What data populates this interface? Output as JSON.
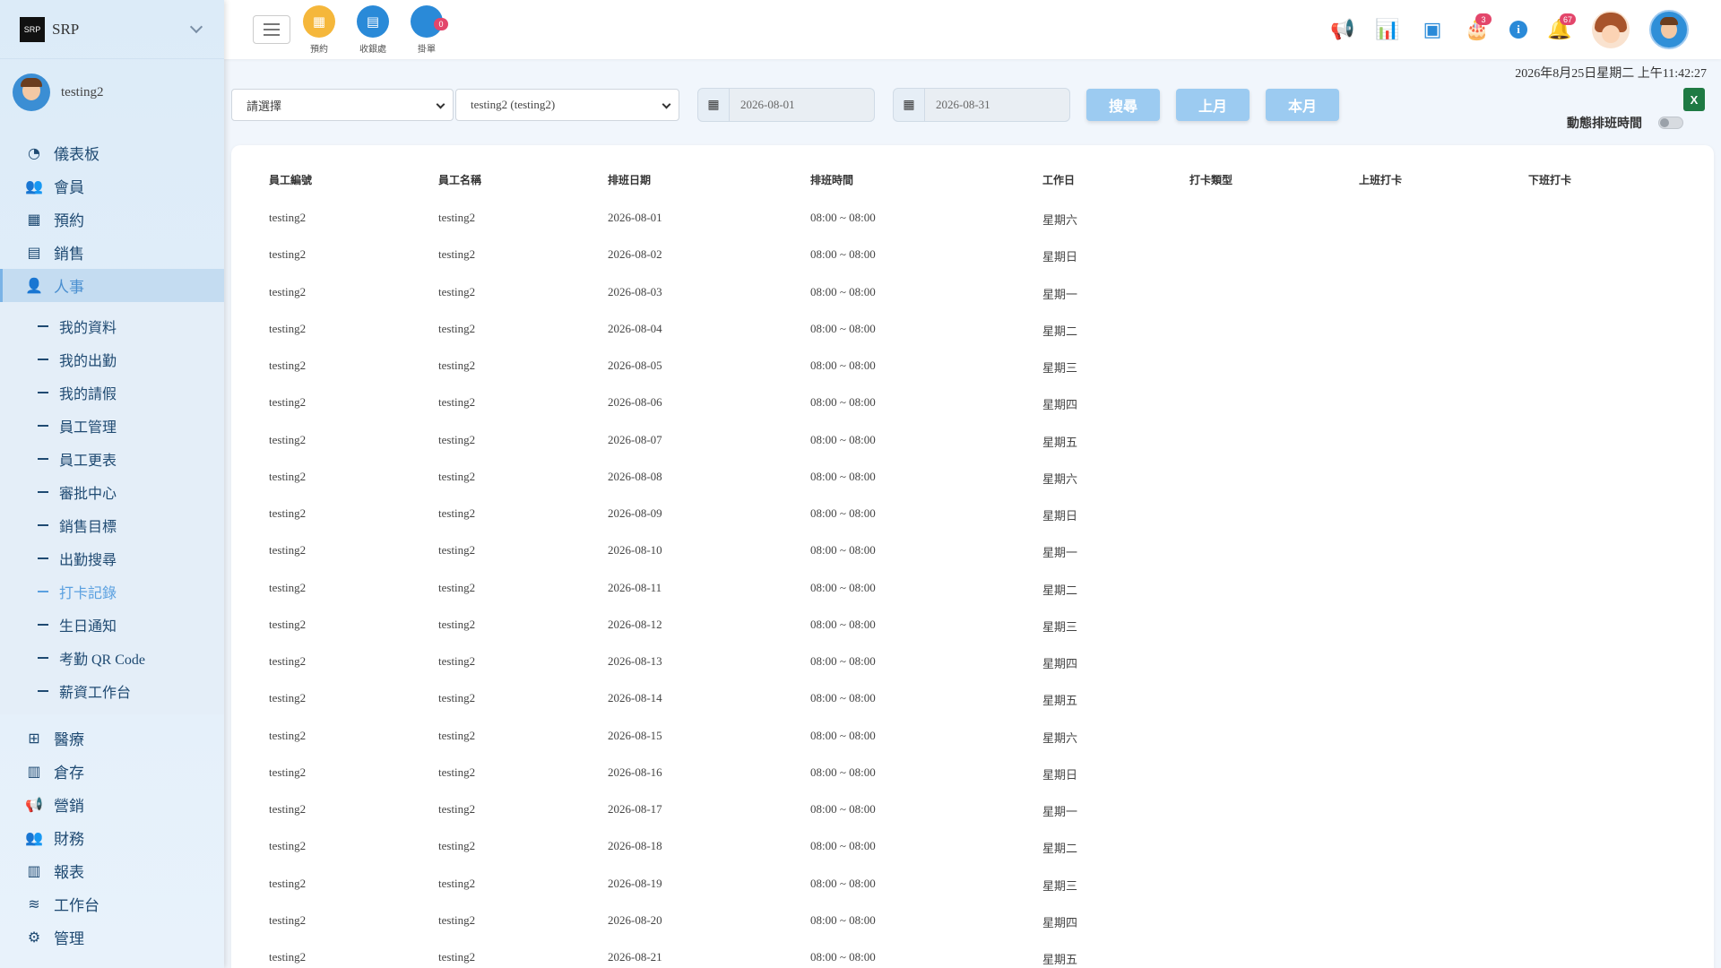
{
  "sidebar": {
    "brand": "SRP",
    "logo_text": "SRP",
    "username": "testing2",
    "menu_top": [
      {
        "label": "儀表板",
        "icon": "pie-chart-icon",
        "glyph": "◔"
      },
      {
        "label": "會員",
        "icon": "users-icon",
        "glyph": "👥"
      },
      {
        "label": "預約",
        "icon": "calendar-icon",
        "glyph": "▦"
      },
      {
        "label": "銷售",
        "icon": "id-card-icon",
        "glyph": "▤"
      },
      {
        "label": "人事",
        "icon": "user-icon",
        "glyph": "👤"
      }
    ],
    "submenu": [
      "我的資料",
      "我的出勤",
      "我的請假",
      "員工管理",
      "員工更表",
      "審批中心",
      "銷售目標",
      "出勤搜尋",
      "打卡記錄",
      "生日通知",
      "考勤 QR Code",
      "薪資工作台"
    ],
    "menu_bottom": [
      {
        "label": "醫療",
        "icon": "medical-icon",
        "glyph": "⊞"
      },
      {
        "label": "倉存",
        "icon": "warehouse-icon",
        "glyph": "▥"
      },
      {
        "label": "營銷",
        "icon": "megaphone-icon",
        "glyph": "📢"
      },
      {
        "label": "財務",
        "icon": "users-icon",
        "glyph": "👥"
      },
      {
        "label": "報表",
        "icon": "bar-chart-icon",
        "glyph": "▥"
      },
      {
        "label": "工作台",
        "icon": "layers-icon",
        "glyph": "≋"
      },
      {
        "label": "管理",
        "icon": "gear-icon",
        "glyph": "⚙"
      }
    ]
  },
  "topbar": {
    "quick": [
      {
        "label": "預約",
        "icon": "calendar-icon",
        "glyph": "▦",
        "color": "#f5b73b",
        "badge": ""
      },
      {
        "label": "收銀處",
        "icon": "cashier-icon",
        "glyph": "▤",
        "color": "#2a8ad8",
        "badge": ""
      },
      {
        "label": "掛單",
        "icon": "pending-icon",
        "glyph": "",
        "color": "#2a8ad8",
        "badge": "0"
      }
    ],
    "right": {
      "megaphone_glyph": "📢",
      "chart_glyph": "📊",
      "qr_glyph": "▣",
      "cake_glyph": "🎂",
      "cake_badge": "3",
      "info_glyph": "i",
      "bell_glyph": "🔔",
      "bell_badge": "67"
    }
  },
  "datetime": "2026年8月25日星期二 上午11:42:27",
  "filters": {
    "select1": "請選擇",
    "select2": "testing2 (testing2)",
    "date_from": "2026-08-01",
    "date_to": "2026-08-31",
    "calendar_glyph": "▦",
    "search_label": "搜尋",
    "prev_month_label": "上月",
    "this_month_label": "本月",
    "excel_glyph": "X",
    "toggle_label": "動態排班時間"
  },
  "table": {
    "headers": [
      "員工編號",
      "員工名稱",
      "排班日期",
      "排班時間",
      "工作日",
      "打卡類型",
      "上班打卡",
      "下班打卡"
    ],
    "rows": [
      [
        "testing2",
        "testing2",
        "2026-08-01",
        "08:00 ~ 08:00",
        "星期六"
      ],
      [
        "testing2",
        "testing2",
        "2026-08-02",
        "08:00 ~ 08:00",
        "星期日"
      ],
      [
        "testing2",
        "testing2",
        "2026-08-03",
        "08:00 ~ 08:00",
        "星期一"
      ],
      [
        "testing2",
        "testing2",
        "2026-08-04",
        "08:00 ~ 08:00",
        "星期二"
      ],
      [
        "testing2",
        "testing2",
        "2026-08-05",
        "08:00 ~ 08:00",
        "星期三"
      ],
      [
        "testing2",
        "testing2",
        "2026-08-06",
        "08:00 ~ 08:00",
        "星期四"
      ],
      [
        "testing2",
        "testing2",
        "2026-08-07",
        "08:00 ~ 08:00",
        "星期五"
      ],
      [
        "testing2",
        "testing2",
        "2026-08-08",
        "08:00 ~ 08:00",
        "星期六"
      ],
      [
        "testing2",
        "testing2",
        "2026-08-09",
        "08:00 ~ 08:00",
        "星期日"
      ],
      [
        "testing2",
        "testing2",
        "2026-08-10",
        "08:00 ~ 08:00",
        "星期一"
      ],
      [
        "testing2",
        "testing2",
        "2026-08-11",
        "08:00 ~ 08:00",
        "星期二"
      ],
      [
        "testing2",
        "testing2",
        "2026-08-12",
        "08:00 ~ 08:00",
        "星期三"
      ],
      [
        "testing2",
        "testing2",
        "2026-08-13",
        "08:00 ~ 08:00",
        "星期四"
      ],
      [
        "testing2",
        "testing2",
        "2026-08-14",
        "08:00 ~ 08:00",
        "星期五"
      ],
      [
        "testing2",
        "testing2",
        "2026-08-15",
        "08:00 ~ 08:00",
        "星期六"
      ],
      [
        "testing2",
        "testing2",
        "2026-08-16",
        "08:00 ~ 08:00",
        "星期日"
      ],
      [
        "testing2",
        "testing2",
        "2026-08-17",
        "08:00 ~ 08:00",
        "星期一"
      ],
      [
        "testing2",
        "testing2",
        "2026-08-18",
        "08:00 ~ 08:00",
        "星期二"
      ],
      [
        "testing2",
        "testing2",
        "2026-08-19",
        "08:00 ~ 08:00",
        "星期三"
      ],
      [
        "testing2",
        "testing2",
        "2026-08-20",
        "08:00 ~ 08:00",
        "星期四"
      ],
      [
        "testing2",
        "testing2",
        "2026-08-21",
        "08:00 ~ 08:00",
        "星期五"
      ]
    ]
  }
}
